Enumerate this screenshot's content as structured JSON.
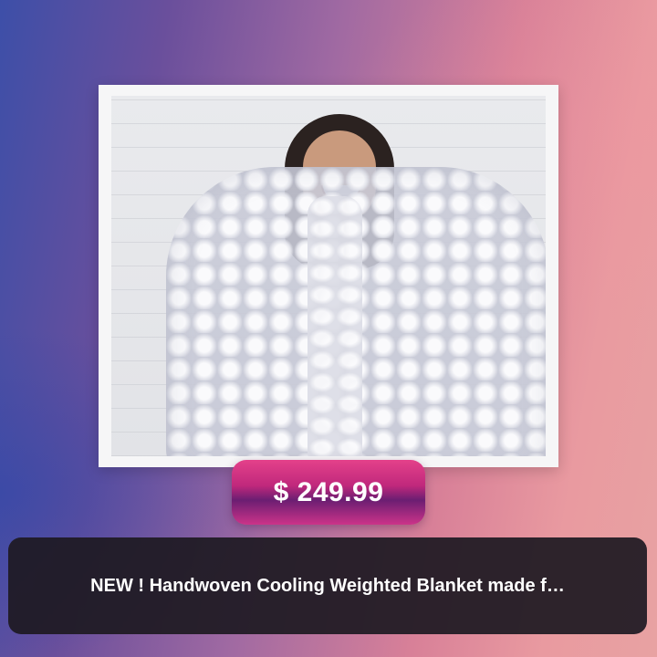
{
  "product": {
    "price": "$ 249.99",
    "title": "NEW ! Handwoven Cooling Weighted Blanket made f…",
    "image_alt": "Woman wrapped in a chunky knit white blanket"
  },
  "colors": {
    "price_pill_top": "#e4418a",
    "price_pill_mid": "#6b1e72",
    "title_bar_bg": "#1e1a22",
    "text": "#ffffff"
  }
}
